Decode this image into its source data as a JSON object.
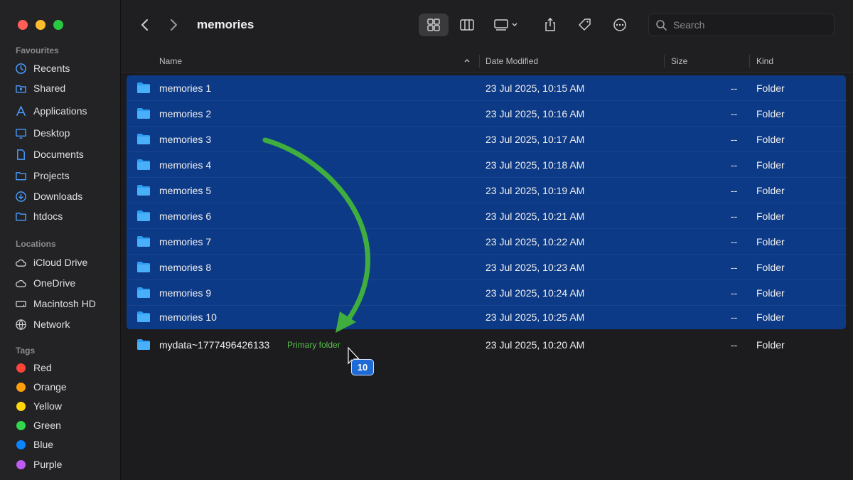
{
  "window": {
    "title": "memories"
  },
  "sidebar": {
    "favourites_label": "Favourites",
    "favourites": [
      {
        "label": "Recents",
        "icon": "clock-icon"
      },
      {
        "label": "Shared",
        "icon": "shared-folder-icon"
      },
      {
        "label": "Applications",
        "icon": "applications-icon"
      },
      {
        "label": "Desktop",
        "icon": "desktop-icon"
      },
      {
        "label": "Documents",
        "icon": "document-icon"
      },
      {
        "label": "Projects",
        "icon": "folder-icon"
      },
      {
        "label": "Downloads",
        "icon": "download-icon"
      },
      {
        "label": "htdocs",
        "icon": "folder-icon"
      }
    ],
    "locations_label": "Locations",
    "locations": [
      {
        "label": "iCloud Drive",
        "icon": "cloud-icon"
      },
      {
        "label": "OneDrive",
        "icon": "cloud-icon"
      },
      {
        "label": "Macintosh HD",
        "icon": "disk-icon"
      },
      {
        "label": "Network",
        "icon": "globe-icon"
      }
    ],
    "tags_label": "Tags",
    "tags": [
      {
        "label": "Red",
        "color": "#ff453a"
      },
      {
        "label": "Orange",
        "color": "#ff9f0a"
      },
      {
        "label": "Yellow",
        "color": "#ffd60a"
      },
      {
        "label": "Green",
        "color": "#32d74b"
      },
      {
        "label": "Blue",
        "color": "#0a84ff"
      },
      {
        "label": "Purple",
        "color": "#bf5af2"
      }
    ]
  },
  "toolbar": {
    "back_icon": "chevron-left-icon",
    "forward_icon": "chevron-right-icon",
    "view_icons": [
      "grid-view-icon",
      "column-view-icon",
      "gallery-view-icon"
    ],
    "share_icon": "share-icon",
    "tag_icon": "tag-icon",
    "more_icon": "ellipsis-icon",
    "search_placeholder": "Search"
  },
  "columns": {
    "name": "Name",
    "date": "Date Modified",
    "size": "Size",
    "kind": "Kind"
  },
  "files": [
    {
      "name": "memories 1",
      "date": "23 Jul 2025, 10:15 AM",
      "size": "--",
      "kind": "Folder",
      "selected": true
    },
    {
      "name": "memories 2",
      "date": "23 Jul 2025, 10:16 AM",
      "size": "--",
      "kind": "Folder",
      "selected": true
    },
    {
      "name": "memories 3",
      "date": "23 Jul 2025, 10:17 AM",
      "size": "--",
      "kind": "Folder",
      "selected": true
    },
    {
      "name": "memories 4",
      "date": "23 Jul 2025, 10:18 AM",
      "size": "--",
      "kind": "Folder",
      "selected": true
    },
    {
      "name": "memories 5",
      "date": "23 Jul 2025, 10:19 AM",
      "size": "--",
      "kind": "Folder",
      "selected": true
    },
    {
      "name": "memories 6",
      "date": "23 Jul 2025, 10:21 AM",
      "size": "--",
      "kind": "Folder",
      "selected": true
    },
    {
      "name": "memories 7",
      "date": "23 Jul 2025, 10:22 AM",
      "size": "--",
      "kind": "Folder",
      "selected": true
    },
    {
      "name": "memories 8",
      "date": "23 Jul 2025, 10:23 AM",
      "size": "--",
      "kind": "Folder",
      "selected": true
    },
    {
      "name": "memories 9",
      "date": "23 Jul 2025, 10:24 AM",
      "size": "--",
      "kind": "Folder",
      "selected": true
    },
    {
      "name": "memories 10",
      "date": "23 Jul 2025, 10:25 AM",
      "size": "--",
      "kind": "Folder",
      "selected": true
    },
    {
      "name": "mydata~1777496426133",
      "date": "23 Jul 2025, 10:20 AM",
      "size": "--",
      "kind": "Folder",
      "selected": false
    }
  ],
  "annotation": {
    "primary_label": "Primary folder",
    "drag_count": "10",
    "arrow_color": "#3fae3f"
  }
}
